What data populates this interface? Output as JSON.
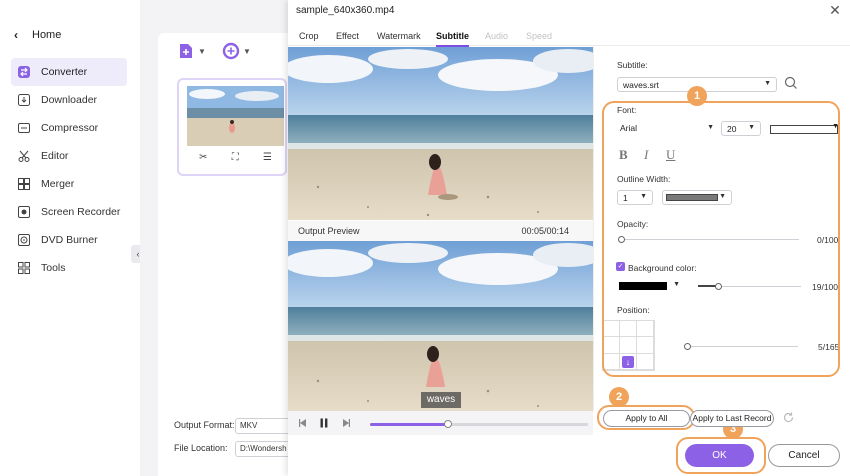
{
  "sidebar": {
    "home_label": "Home",
    "items": [
      {
        "label": "Converter",
        "icon": "converter-icon",
        "active": true
      },
      {
        "label": "Downloader",
        "icon": "downloader-icon"
      },
      {
        "label": "Compressor",
        "icon": "compressor-icon"
      },
      {
        "label": "Editor",
        "icon": "scissors-icon"
      },
      {
        "label": "Merger",
        "icon": "merger-icon"
      },
      {
        "label": "Screen Recorder",
        "icon": "screen-recorder-icon"
      },
      {
        "label": "DVD Burner",
        "icon": "dvd-icon"
      },
      {
        "label": "Tools",
        "icon": "tools-grid-icon"
      }
    ]
  },
  "main": {
    "output_format_label": "Output Format:",
    "output_format_value": "MKV",
    "file_location_label": "File Location:",
    "file_location_value": "D:\\Wondersh"
  },
  "dialog": {
    "title": "sample_640x360.mp4",
    "tabs": [
      {
        "label": "Crop"
      },
      {
        "label": "Effect"
      },
      {
        "label": "Watermark"
      },
      {
        "label": "Subtitle",
        "active": true
      },
      {
        "label": "Audio",
        "disabled": true
      },
      {
        "label": "Speed",
        "disabled": true
      }
    ],
    "preview": {
      "label": "Output Preview",
      "time": "00:05/00:14",
      "subtitle_text": "waves",
      "progress": 0.36
    },
    "settings": {
      "subtitle_label": "Subtitle:",
      "subtitle_file": "waves.srt",
      "font_label": "Font:",
      "font_family": "Arial",
      "font_size": "20",
      "font_color": "#ffffff",
      "outline_width_label": "Outline Width:",
      "outline_width": "1",
      "outline_color": "#7a7a7a",
      "opacity_label": "Opacity:",
      "opacity_value": "0/100",
      "opacity": 0.0,
      "background_color_label": "Background color:",
      "background_color_checked": true,
      "background_color": "#000000",
      "background_value": "19/100",
      "background": 0.19,
      "position_label": "Position:",
      "position_value": "5/165",
      "position": 0.03
    },
    "buttons": {
      "apply_all": "Apply to All",
      "apply_last": "Apply to Last Record",
      "ok": "OK",
      "cancel": "Cancel"
    },
    "steps": [
      "1",
      "2",
      "3"
    ],
    "colors": {
      "accent": "#8d61e6",
      "highlight": "#f0a35a"
    }
  }
}
